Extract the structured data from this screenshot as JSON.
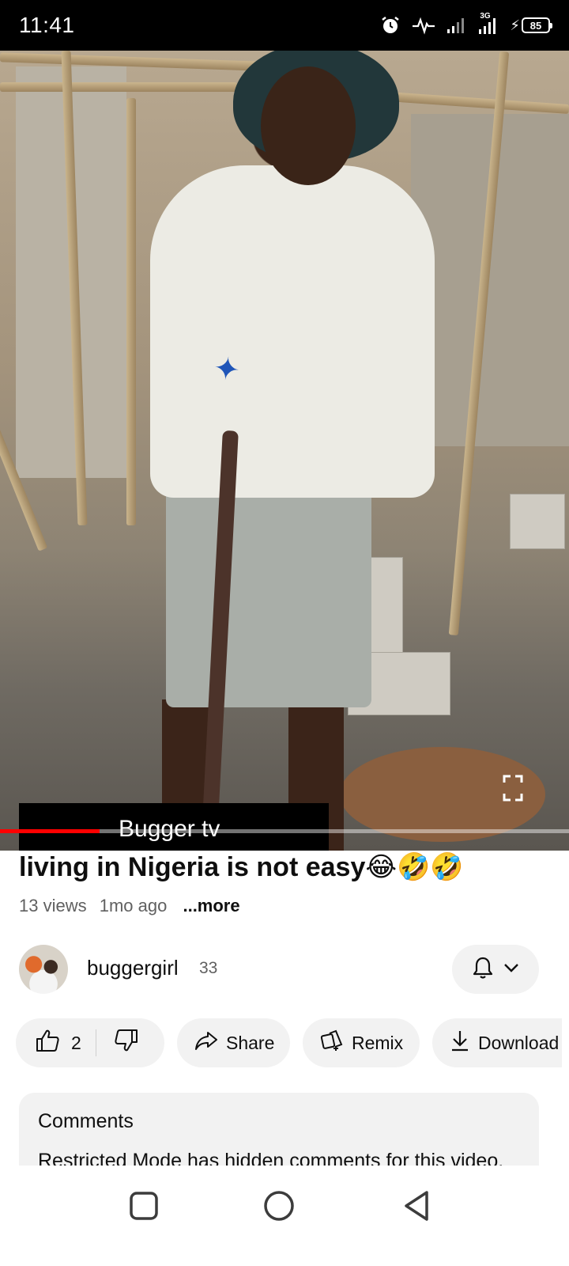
{
  "status_bar": {
    "time": "11:41",
    "network": "3G",
    "battery_level": "85",
    "icons": [
      "alarm-icon",
      "activity-icon",
      "signal-icon",
      "signal-3g-icon",
      "charging-icon",
      "battery-icon"
    ]
  },
  "video": {
    "channel_overlay_text": "Bugger tv",
    "progress_fraction": 0.175,
    "progress_color": "#ff0000",
    "fullscreen_icon": "fullscreen-icon"
  },
  "details": {
    "title": "living in Nigeria is not easy😂🤣🤣",
    "views": "13 views",
    "age": "1mo ago",
    "more_label": "...more"
  },
  "channel": {
    "name": "buggergirl",
    "subscribers": "33",
    "notification_icon": "bell-icon",
    "dropdown_icon": "chevron-down-icon"
  },
  "actions": {
    "like_count": "2",
    "share_label": "Share",
    "remix_label": "Remix",
    "download_label": "Download"
  },
  "comments": {
    "heading": "Comments",
    "body": "Restricted Mode has hidden comments for this video."
  },
  "navbar": {
    "icons": [
      "recents-square-icon",
      "home-circle-icon",
      "back-triangle-icon"
    ]
  },
  "colors": {
    "accent": "#ff0000",
    "chip_background": "#f2f2f2",
    "secondary_text": "#606060"
  }
}
